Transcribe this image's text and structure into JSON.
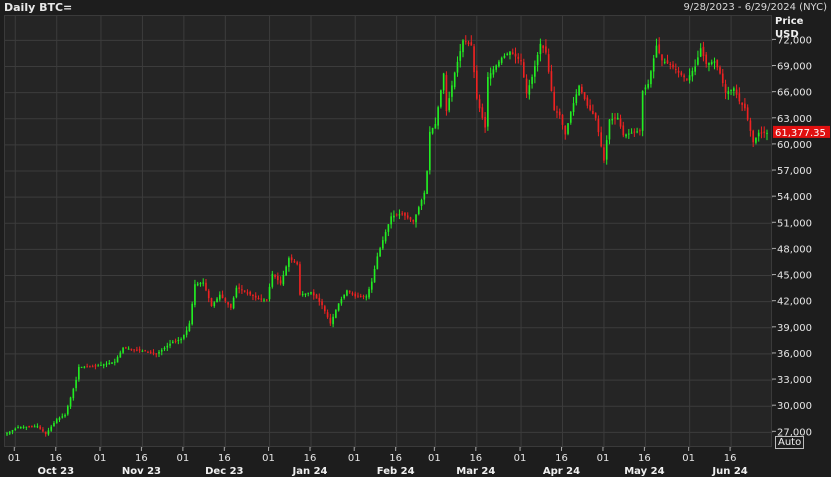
{
  "header": {
    "title": "Daily BTC=",
    "date_range": "9/28/2023 - 6/29/2024 (NYC)"
  },
  "axis": {
    "title_line1": "Price",
    "title_line2": "USD",
    "auto_label": "Auto"
  },
  "chart_data": {
    "type": "candlestick",
    "title": "Daily BTC=",
    "ylabel": "Price USD",
    "ylim": [
      25200,
      74800
    ],
    "yticks": [
      27000,
      30000,
      33000,
      36000,
      39000,
      42000,
      45000,
      48000,
      51000,
      54000,
      57000,
      60000,
      63000,
      66000,
      69000,
      72000
    ],
    "ytick_labels": [
      "27,000",
      "30,000",
      "33,000",
      "36,000",
      "39,000",
      "42,000",
      "45,000",
      "48,000",
      "51,000",
      "54,000",
      "57,000",
      "60,000",
      "63,000",
      "66,000",
      "69,000",
      "72,000"
    ],
    "last_price": 61377.35,
    "last_price_label": "61,377.35",
    "up_color": "#22ee22",
    "down_color": "#ee2222",
    "x_start": "2023-09-28",
    "x_end": "2024-06-29",
    "x_day_ticks": [
      {
        "date": "2023-10-01",
        "label": "01"
      },
      {
        "date": "2023-10-16",
        "label": "16"
      },
      {
        "date": "2023-11-01",
        "label": "01"
      },
      {
        "date": "2023-11-16",
        "label": "16"
      },
      {
        "date": "2023-12-01",
        "label": "01"
      },
      {
        "date": "2023-12-16",
        "label": "16"
      },
      {
        "date": "2024-01-01",
        "label": "01"
      },
      {
        "date": "2024-01-16",
        "label": "16"
      },
      {
        "date": "2024-02-01",
        "label": "01"
      },
      {
        "date": "2024-02-16",
        "label": "16"
      },
      {
        "date": "2024-03-01",
        "label": "01"
      },
      {
        "date": "2024-03-16",
        "label": "16"
      },
      {
        "date": "2024-04-01",
        "label": "01"
      },
      {
        "date": "2024-04-16",
        "label": "16"
      },
      {
        "date": "2024-05-01",
        "label": "01"
      },
      {
        "date": "2024-05-16",
        "label": "16"
      },
      {
        "date": "2024-06-01",
        "label": "01"
      },
      {
        "date": "2024-06-16",
        "label": "16"
      }
    ],
    "x_month_labels": [
      {
        "date": "2023-10-16",
        "label": "Oct 23"
      },
      {
        "date": "2023-11-16",
        "label": "Nov 23"
      },
      {
        "date": "2023-12-16",
        "label": "Dec 23"
      },
      {
        "date": "2024-01-16",
        "label": "Jan 24"
      },
      {
        "date": "2024-02-16",
        "label": "Feb 24"
      },
      {
        "date": "2024-03-16",
        "label": "Mar 24"
      },
      {
        "date": "2024-04-16",
        "label": "Apr 24"
      },
      {
        "date": "2024-05-16",
        "label": "May 24"
      },
      {
        "date": "2024-06-16",
        "label": "Jun 24"
      }
    ],
    "close_series": [
      [
        "2023-09-28",
        26900
      ],
      [
        "2023-10-02",
        27600
      ],
      [
        "2023-10-09",
        27700
      ],
      [
        "2023-10-12",
        26800
      ],
      [
        "2023-10-16",
        28500
      ],
      [
        "2023-10-19",
        29000
      ],
      [
        "2023-10-20",
        30000
      ],
      [
        "2023-10-23",
        33000
      ],
      [
        "2023-10-24",
        34500
      ],
      [
        "2023-10-30",
        34600
      ],
      [
        "2023-11-06",
        35100
      ],
      [
        "2023-11-09",
        36700
      ],
      [
        "2023-11-13",
        36500
      ],
      [
        "2023-11-17",
        36300
      ],
      [
        "2023-11-21",
        36000
      ],
      [
        "2023-11-27",
        37400
      ],
      [
        "2023-11-30",
        37700
      ],
      [
        "2023-12-02",
        38700
      ],
      [
        "2023-12-03",
        39500
      ],
      [
        "2023-12-05",
        44000
      ],
      [
        "2023-12-08",
        44200
      ],
      [
        "2023-12-11",
        41500
      ],
      [
        "2023-12-14",
        42800
      ],
      [
        "2023-12-18",
        41300
      ],
      [
        "2023-12-20",
        43600
      ],
      [
        "2023-12-24",
        43000
      ],
      [
        "2023-12-28",
        42300
      ],
      [
        "2023-12-31",
        42200
      ],
      [
        "2024-01-02",
        45200
      ],
      [
        "2024-01-05",
        44100
      ],
      [
        "2024-01-08",
        47000
      ],
      [
        "2024-01-11",
        46300
      ],
      [
        "2024-01-12",
        42800
      ],
      [
        "2024-01-16",
        43100
      ],
      [
        "2024-01-20",
        41600
      ],
      [
        "2024-01-23",
        39500
      ],
      [
        "2024-01-26",
        41800
      ],
      [
        "2024-01-29",
        43300
      ],
      [
        "2024-02-01",
        42600
      ],
      [
        "2024-02-05",
        42600
      ],
      [
        "2024-02-07",
        44300
      ],
      [
        "2024-02-09",
        47200
      ],
      [
        "2024-02-12",
        50000
      ],
      [
        "2024-02-14",
        51800
      ],
      [
        "2024-02-18",
        52100
      ],
      [
        "2024-02-22",
        51200
      ],
      [
        "2024-02-26",
        54500
      ],
      [
        "2024-02-27",
        57000
      ],
      [
        "2024-02-28",
        61500
      ],
      [
        "2024-03-01",
        62400
      ],
      [
        "2024-03-04",
        68200
      ],
      [
        "2024-03-05",
        63900
      ],
      [
        "2024-03-08",
        68300
      ],
      [
        "2024-03-11",
        72000
      ],
      [
        "2024-03-14",
        71400
      ],
      [
        "2024-03-16",
        65300
      ],
      [
        "2024-03-19",
        62000
      ],
      [
        "2024-03-20",
        67800
      ],
      [
        "2024-03-25",
        70000
      ],
      [
        "2024-03-28",
        70700
      ],
      [
        "2024-04-01",
        69600
      ],
      [
        "2024-04-03",
        65900
      ],
      [
        "2024-04-05",
        67800
      ],
      [
        "2024-04-08",
        71600
      ],
      [
        "2024-04-10",
        70600
      ],
      [
        "2024-04-13",
        64000
      ],
      [
        "2024-04-15",
        63400
      ],
      [
        "2024-04-17",
        61200
      ],
      [
        "2024-04-19",
        63800
      ],
      [
        "2024-04-22",
        66800
      ],
      [
        "2024-04-25",
        64500
      ],
      [
        "2024-04-28",
        63100
      ],
      [
        "2024-05-01",
        58200
      ],
      [
        "2024-05-03",
        62900
      ],
      [
        "2024-05-06",
        63100
      ],
      [
        "2024-05-08",
        61100
      ],
      [
        "2024-05-12",
        61500
      ],
      [
        "2024-05-14",
        61600
      ],
      [
        "2024-05-15",
        66200
      ],
      [
        "2024-05-17",
        67000
      ],
      [
        "2024-05-20",
        71400
      ],
      [
        "2024-05-22",
        69700
      ],
      [
        "2024-05-25",
        69200
      ],
      [
        "2024-05-28",
        68300
      ],
      [
        "2024-05-31",
        67500
      ],
      [
        "2024-06-03",
        69000
      ],
      [
        "2024-06-05",
        71100
      ],
      [
        "2024-06-07",
        69300
      ],
      [
        "2024-06-10",
        69600
      ],
      [
        "2024-06-12",
        68200
      ],
      [
        "2024-06-14",
        66000
      ],
      [
        "2024-06-17",
        66500
      ],
      [
        "2024-06-19",
        65000
      ],
      [
        "2024-06-21",
        64200
      ],
      [
        "2024-06-24",
        60300
      ],
      [
        "2024-06-26",
        61400
      ],
      [
        "2024-06-28",
        61377
      ]
    ]
  }
}
